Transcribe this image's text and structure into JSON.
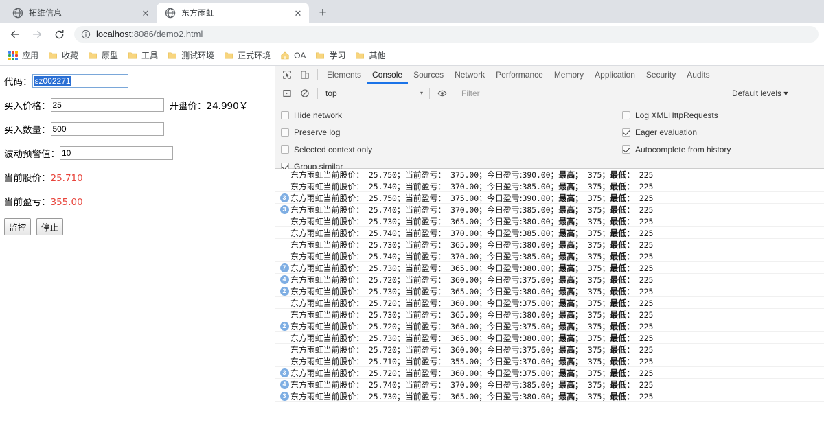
{
  "browser": {
    "tabs": [
      {
        "title": "拓维信息",
        "favicon": "globe-icon",
        "active": false
      },
      {
        "title": "东方雨虹",
        "favicon": "globe-icon",
        "active": true
      }
    ],
    "new_tab_label": "+",
    "close_label": "✕",
    "nav": {
      "back_label": "←",
      "forward_label": "→",
      "reload_label": "↻"
    },
    "omnibox": {
      "info_icon": "info-circle-icon",
      "url_host": "localhost",
      "url_path": ":8086/demo2.html",
      "full_url": "localhost:8086/demo2.html"
    },
    "bookmarks": [
      {
        "label": "应用",
        "icon": "apps-grid-icon"
      },
      {
        "label": "收藏",
        "icon": "folder-icon"
      },
      {
        "label": "原型",
        "icon": "folder-icon"
      },
      {
        "label": "工具",
        "icon": "folder-icon"
      },
      {
        "label": "测试环境",
        "icon": "folder-icon"
      },
      {
        "label": "正式环境",
        "icon": "folder-icon"
      },
      {
        "label": "OA",
        "icon": "home-icon"
      },
      {
        "label": "学习",
        "icon": "folder-icon"
      },
      {
        "label": "其他",
        "icon": "folder-icon"
      }
    ]
  },
  "page": {
    "fields": [
      {
        "label": "代码：",
        "value": "sz002271",
        "selected": true,
        "width": 140
      },
      {
        "label": "买入价格：",
        "value": "25",
        "selected": false,
        "width": 165
      },
      {
        "label": "买入数量：",
        "value": "500",
        "selected": false,
        "width": 165
      },
      {
        "label": "波动预警值：",
        "value": "10",
        "selected": false,
        "width": 165
      }
    ],
    "open_price_note": "开盘价：24.990￥",
    "readouts": [
      {
        "label": "当前股价：",
        "value": "25.710"
      },
      {
        "label": "当前盈亏：",
        "value": "355.00"
      }
    ],
    "buttons": [
      {
        "label": "监控"
      },
      {
        "label": "停止"
      }
    ],
    "accent_value_color": "#e8453c",
    "selection_color": "#2a6fd4"
  },
  "devtools": {
    "icons": {
      "inspect": "inspect-cursor-icon",
      "device_toolbar": "device-toolbar-icon",
      "execute": "execute-icon",
      "clear_console": "clear-console-icon",
      "eye": "eye-icon"
    },
    "tabs": [
      {
        "label": "Elements",
        "active": false
      },
      {
        "label": "Console",
        "active": true
      },
      {
        "label": "Sources",
        "active": false
      },
      {
        "label": "Network",
        "active": false
      },
      {
        "label": "Performance",
        "active": false
      },
      {
        "label": "Memory",
        "active": false
      },
      {
        "label": "Application",
        "active": false
      },
      {
        "label": "Security",
        "active": false
      },
      {
        "label": "Audits",
        "active": false
      }
    ],
    "console_bar": {
      "context": "top",
      "caret": "▾",
      "filter_placeholder": "Filter",
      "levels_label": "Default levels ▾"
    },
    "settings": {
      "left": [
        {
          "label": "Hide network",
          "checked": false
        },
        {
          "label": "Preserve log",
          "checked": false
        },
        {
          "label": "Selected context only",
          "checked": false
        },
        {
          "label": "Group similar",
          "checked": true
        }
      ],
      "right": [
        {
          "label": "Log XMLHttpRequests",
          "checked": false
        },
        {
          "label": "Eager evaluation",
          "checked": true
        },
        {
          "label": "Autocomplete from history",
          "checked": true
        }
      ]
    },
    "log_template": {
      "name": "东方雨虹",
      "price_label": "当前股价：",
      "pnl_label": "当前盈亏：",
      "today_label": "今日盈亏:",
      "high_label": "最高；",
      "low_label": "最低：",
      "sep": "；"
    },
    "log_rows": [
      {
        "badge": null,
        "price": "25.750",
        "pnl": "375.00",
        "today": "390.00",
        "high": "375",
        "low": "225"
      },
      {
        "badge": null,
        "price": "25.740",
        "pnl": "370.00",
        "today": "385.00",
        "high": "375",
        "low": "225"
      },
      {
        "badge": "3",
        "price": "25.750",
        "pnl": "375.00",
        "today": "390.00",
        "high": "375",
        "low": "225"
      },
      {
        "badge": "3",
        "price": "25.740",
        "pnl": "370.00",
        "today": "385.00",
        "high": "375",
        "low": "225"
      },
      {
        "badge": null,
        "price": "25.730",
        "pnl": "365.00",
        "today": "380.00",
        "high": "375",
        "low": "225"
      },
      {
        "badge": null,
        "price": "25.740",
        "pnl": "370.00",
        "today": "385.00",
        "high": "375",
        "low": "225"
      },
      {
        "badge": null,
        "price": "25.730",
        "pnl": "365.00",
        "today": "380.00",
        "high": "375",
        "low": "225"
      },
      {
        "badge": null,
        "price": "25.740",
        "pnl": "370.00",
        "today": "385.00",
        "high": "375",
        "low": "225"
      },
      {
        "badge": "7",
        "price": "25.730",
        "pnl": "365.00",
        "today": "380.00",
        "high": "375",
        "low": "225"
      },
      {
        "badge": "4",
        "price": "25.720",
        "pnl": "360.00",
        "today": "375.00",
        "high": "375",
        "low": "225"
      },
      {
        "badge": "2",
        "price": "25.730",
        "pnl": "365.00",
        "today": "380.00",
        "high": "375",
        "low": "225"
      },
      {
        "badge": null,
        "price": "25.720",
        "pnl": "360.00",
        "today": "375.00",
        "high": "375",
        "low": "225"
      },
      {
        "badge": null,
        "price": "25.730",
        "pnl": "365.00",
        "today": "380.00",
        "high": "375",
        "low": "225"
      },
      {
        "badge": "2",
        "price": "25.720",
        "pnl": "360.00",
        "today": "375.00",
        "high": "375",
        "low": "225"
      },
      {
        "badge": null,
        "price": "25.730",
        "pnl": "365.00",
        "today": "380.00",
        "high": "375",
        "low": "225"
      },
      {
        "badge": null,
        "price": "25.720",
        "pnl": "360.00",
        "today": "375.00",
        "high": "375",
        "low": "225"
      },
      {
        "badge": null,
        "price": "25.710",
        "pnl": "355.00",
        "today": "370.00",
        "high": "375",
        "low": "225"
      },
      {
        "badge": "3",
        "price": "25.720",
        "pnl": "360.00",
        "today": "375.00",
        "high": "375",
        "low": "225"
      },
      {
        "badge": "4",
        "price": "25.740",
        "pnl": "370.00",
        "today": "385.00",
        "high": "375",
        "low": "225"
      },
      {
        "badge": "3",
        "price": "25.730",
        "pnl": "365.00",
        "today": "380.00",
        "high": "375",
        "low": "225"
      }
    ]
  }
}
